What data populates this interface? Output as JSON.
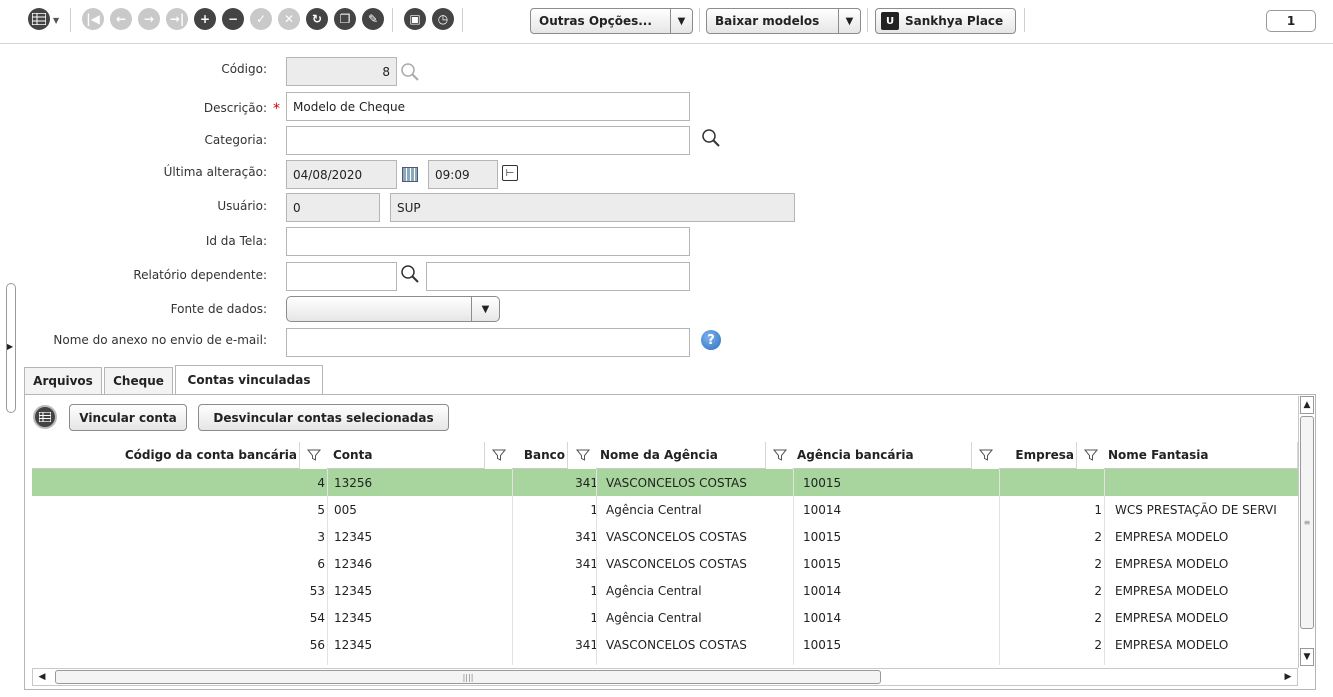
{
  "toolbar": {
    "outras_opcoes": "Outras Opções...",
    "baixar_modelos": "Baixar modelos",
    "sankhya_place": "Sankhya Place",
    "page": "1"
  },
  "form": {
    "codigo": {
      "label": "Código:",
      "value": "8"
    },
    "descricao": {
      "label": "Descrição:",
      "value": "Modelo de Cheque"
    },
    "categoria": {
      "label": "Categoria:",
      "value": ""
    },
    "ultima_alteracao": {
      "label": "Última alteração:",
      "date": "04/08/2020",
      "time": "09:09"
    },
    "usuario": {
      "label": "Usuário:",
      "code": "0",
      "name": "SUP"
    },
    "id_tela": {
      "label": "Id da Tela:",
      "value": ""
    },
    "relatorio_dependente": {
      "label": "Relatório dependente:",
      "value": ""
    },
    "fonte_dados": {
      "label": "Fonte de dados:",
      "value": ""
    },
    "nome_anexo": {
      "label": "Nome do anexo no envio de e-mail:",
      "value": ""
    }
  },
  "tabs": [
    "Arquivos",
    "Cheque",
    "Contas vinculadas"
  ],
  "actions": {
    "vincular": "Vincular conta",
    "desvincular": "Desvincular contas selecionadas"
  },
  "grid": {
    "headers": [
      "Código da conta bancária",
      "Conta",
      "Banco",
      "Nome da Agência",
      "Agência bancária",
      "Empresa",
      "Nome Fantasia"
    ],
    "rows": [
      [
        "4",
        "13256",
        "341",
        "VASCONCELOS COSTAS",
        "10015",
        "",
        ""
      ],
      [
        "5",
        "005",
        "1",
        "Agência Central",
        "10014",
        "1",
        "WCS PRESTAÇÃO DE SERVI"
      ],
      [
        "3",
        "12345",
        "341",
        "VASCONCELOS COSTAS",
        "10015",
        "2",
        "EMPRESA MODELO"
      ],
      [
        "6",
        "12346",
        "341",
        "VASCONCELOS COSTAS",
        "10015",
        "2",
        "EMPRESA MODELO"
      ],
      [
        "53",
        "12345",
        "1",
        "Agência Central",
        "10014",
        "2",
        "EMPRESA MODELO"
      ],
      [
        "54",
        "12345",
        "1",
        "Agência Central",
        "10014",
        "2",
        "EMPRESA MODELO"
      ],
      [
        "56",
        "12345",
        "341",
        "VASCONCELOS COSTAS",
        "10015",
        "2",
        "EMPRESA MODELO"
      ]
    ]
  }
}
